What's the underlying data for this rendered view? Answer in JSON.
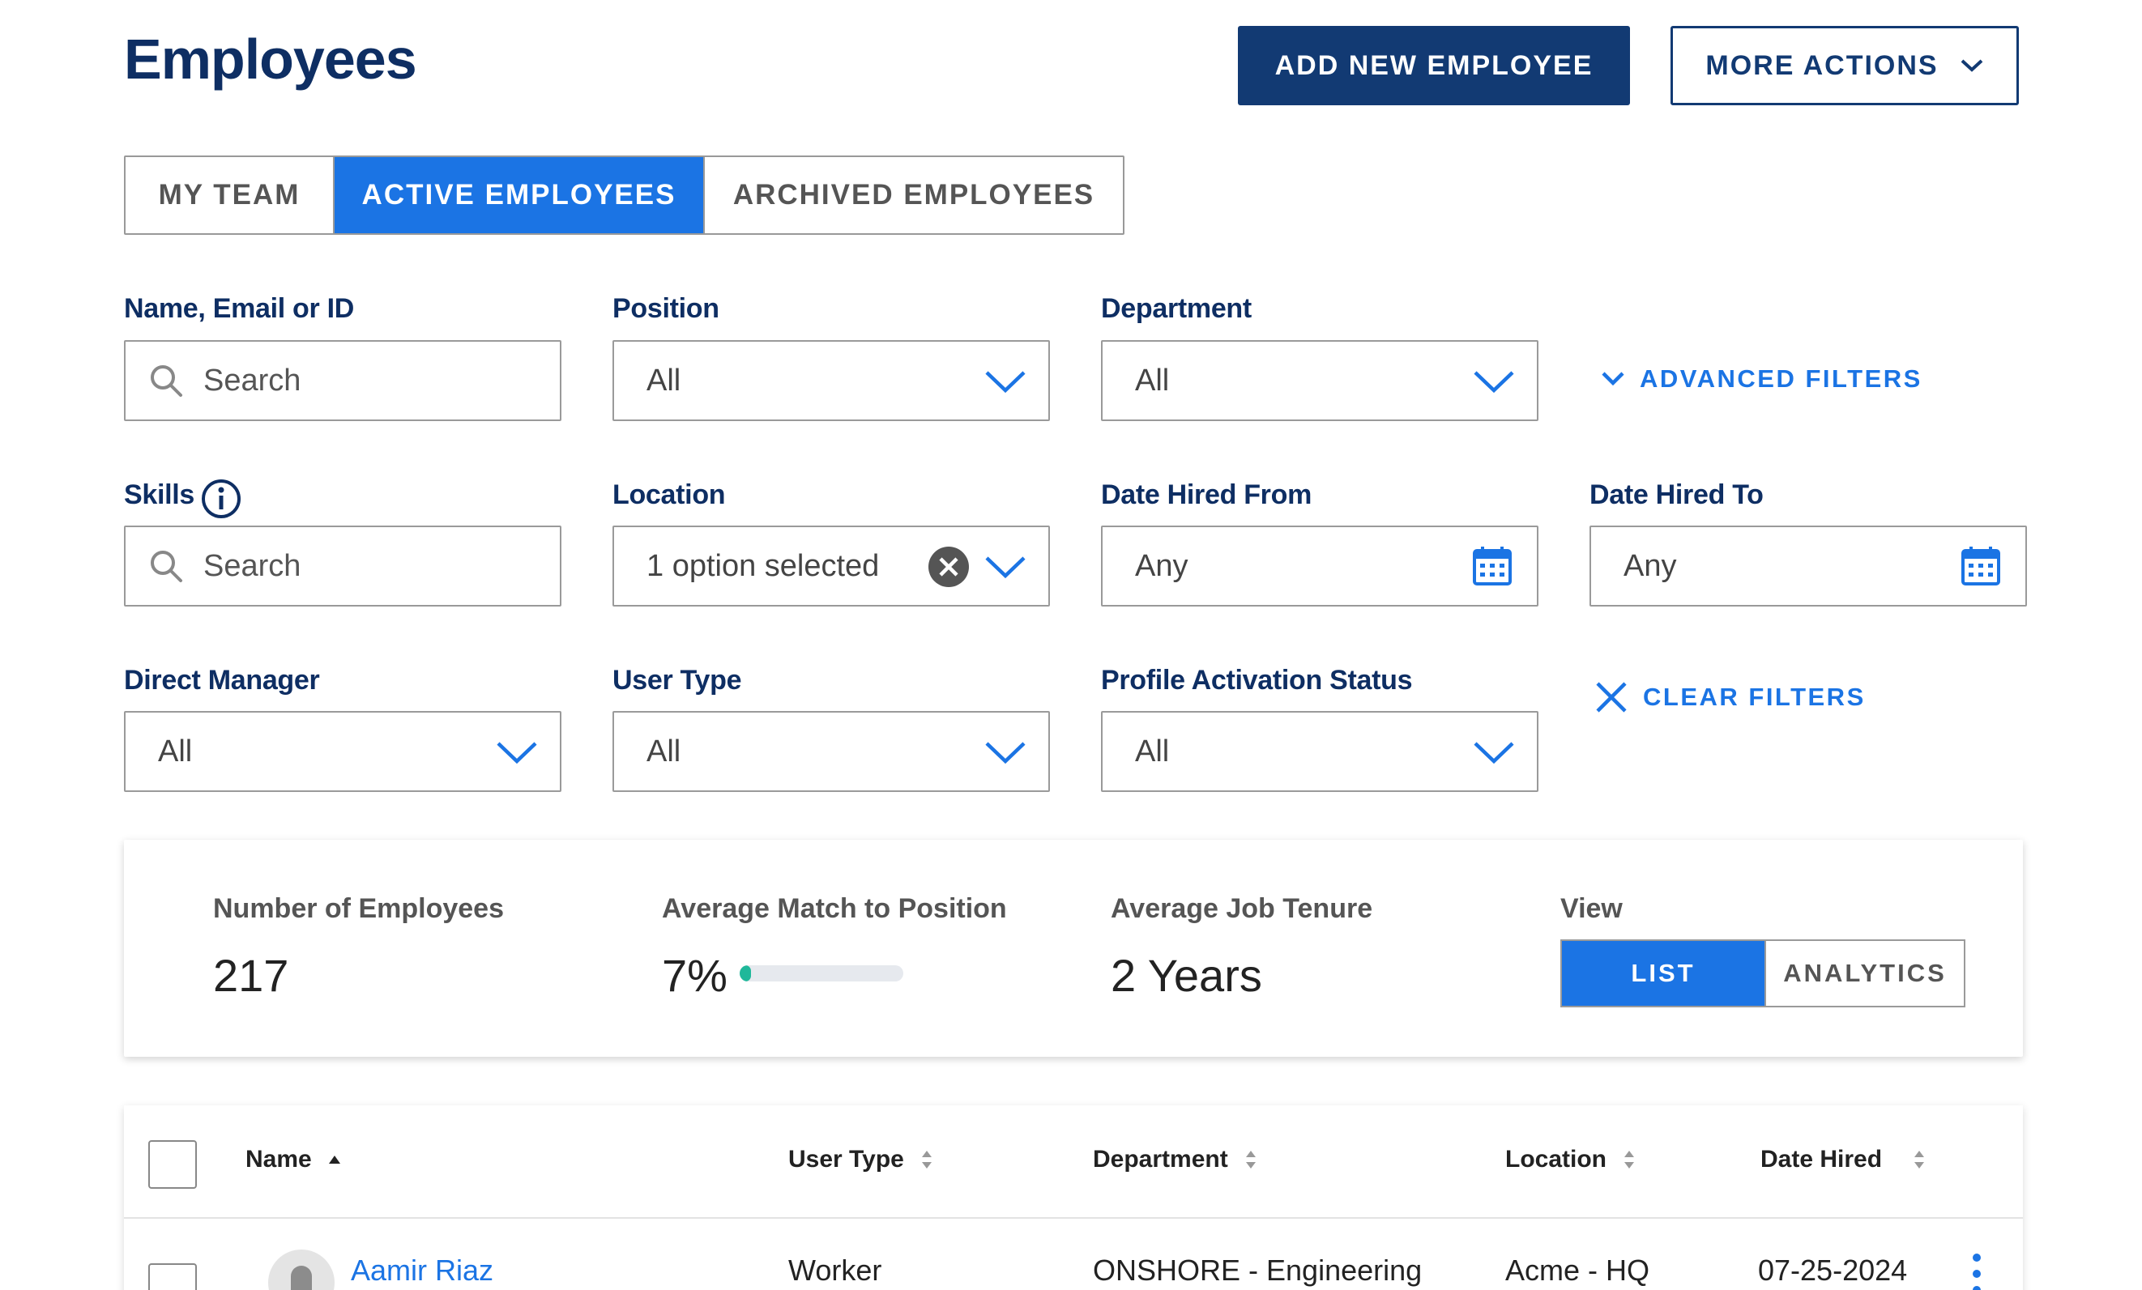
{
  "header": {
    "title": "Employees",
    "add_button": "ADD NEW EMPLOYEE",
    "more_actions": "MORE ACTIONS"
  },
  "tabs": [
    {
      "label": "MY TEAM",
      "active": false
    },
    {
      "label": "ACTIVE EMPLOYEES",
      "active": true
    },
    {
      "label": "ARCHIVED EMPLOYEES",
      "active": false
    }
  ],
  "filters": {
    "name": {
      "label": "Name, Email or ID",
      "placeholder": "Search"
    },
    "position": {
      "label": "Position",
      "value": "All"
    },
    "department": {
      "label": "Department",
      "value": "All"
    },
    "advanced": "ADVANCED FILTERS",
    "skills": {
      "label": "Skills",
      "placeholder": "Search"
    },
    "location": {
      "label": "Location",
      "value": "1 option selected"
    },
    "date_from": {
      "label": "Date Hired From",
      "value": "Any"
    },
    "date_to": {
      "label": "Date Hired To",
      "value": "Any"
    },
    "manager": {
      "label": "Direct Manager",
      "value": "All"
    },
    "user_type": {
      "label": "User Type",
      "value": "All"
    },
    "activation": {
      "label": "Profile Activation Status",
      "value": "All"
    },
    "clear": "CLEAR FILTERS"
  },
  "stats": {
    "employees": {
      "label": "Number of Employees",
      "value": "217"
    },
    "match": {
      "label": "Average Match to Position",
      "value": "7%",
      "percent": 7
    },
    "tenure": {
      "label": "Average Job Tenure",
      "value": "2 Years"
    },
    "view": {
      "label": "View",
      "list": "LIST",
      "analytics": "ANALYTICS",
      "selected": "LIST"
    }
  },
  "table": {
    "columns": [
      "Name",
      "User Type",
      "Department",
      "Location",
      "Date Hired"
    ],
    "rows": [
      {
        "name": "Aamir Riaz",
        "user_type": "Worker",
        "department": "ONSHORE - Engineering",
        "location": "Acme - HQ",
        "date_hired": "07-25-2024"
      }
    ]
  },
  "colors": {
    "navy": "#123a73",
    "title": "#0e2e63",
    "accent": "#1b74e4",
    "progress": "#1fb89a"
  }
}
